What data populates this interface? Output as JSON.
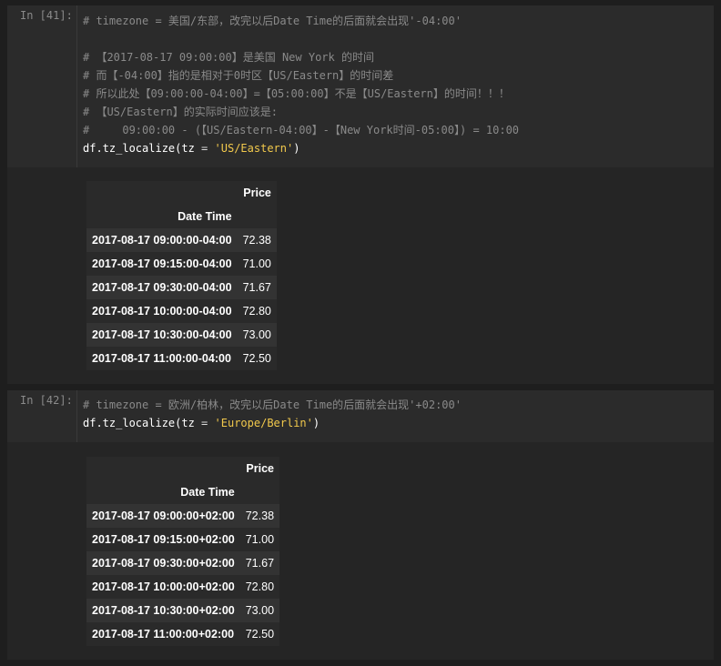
{
  "cells": [
    {
      "prompt": "In [41]:",
      "code": [
        "# timezone = 美国/东部，改完以后Date Time的后面就会出现'-04:00'",
        "# 【2017-08-17 09:00:00】是美国 New York 的时间",
        "# 而【-04:00】指的是相对于0时区【US/Eastern】的时间差",
        "# 所以此处【09:00:00-04:00】=【05:00:00】不是【US/Eastern】的时间！！！",
        "# 【US/Eastern】的实际时间应该是:",
        "#     09:00:00 - (【US/Eastern-04:00】-【New York时间-05:00】) = 10:00"
      ],
      "call": {
        "func": "df.tz_localize(tz ",
        "eq": "=",
        "arg": "'US/Eastern'",
        "close": ")"
      },
      "output": {
        "column": "Price",
        "index_name": "Date Time",
        "rows": [
          {
            "index": "2017-08-17 09:00:00-04:00",
            "value": "72.38"
          },
          {
            "index": "2017-08-17 09:15:00-04:00",
            "value": "71.00"
          },
          {
            "index": "2017-08-17 09:30:00-04:00",
            "value": "71.67"
          },
          {
            "index": "2017-08-17 10:00:00-04:00",
            "value": "72.80"
          },
          {
            "index": "2017-08-17 10:30:00-04:00",
            "value": "73.00"
          },
          {
            "index": "2017-08-17 11:00:00-04:00",
            "value": "72.50"
          }
        ]
      }
    },
    {
      "prompt": "In [42]:",
      "code": [
        "# timezone = 欧洲/柏林，改完以后Date Time的后面就会出现'+02:00'"
      ],
      "call": {
        "func": "df.tz_localize(tz ",
        "eq": "=",
        "arg": "'Europe/Berlin'",
        "close": ")"
      },
      "output": {
        "column": "Price",
        "index_name": "Date Time",
        "rows": [
          {
            "index": "2017-08-17 09:00:00+02:00",
            "value": "72.38"
          },
          {
            "index": "2017-08-17 09:15:00+02:00",
            "value": "71.00"
          },
          {
            "index": "2017-08-17 09:30:00+02:00",
            "value": "71.67"
          },
          {
            "index": "2017-08-17 10:00:00+02:00",
            "value": "72.80"
          },
          {
            "index": "2017-08-17 10:30:00+02:00",
            "value": "73.00"
          },
          {
            "index": "2017-08-17 11:00:00+02:00",
            "value": "72.50"
          }
        ]
      }
    }
  ]
}
